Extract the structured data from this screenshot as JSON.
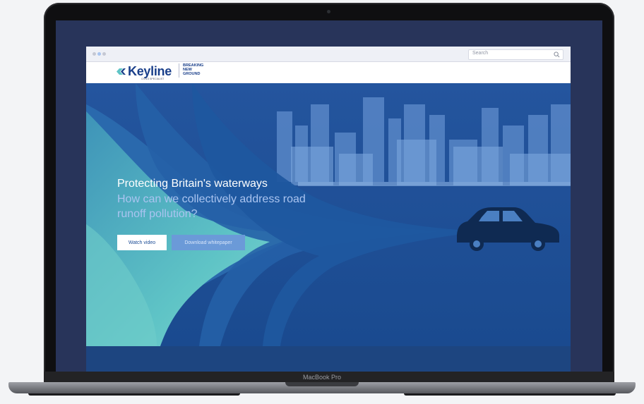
{
  "browser": {
    "search_placeholder": "Search"
  },
  "site": {
    "logo_text": "Keyline",
    "logo_subtext": "CIVILS SPECIALIST",
    "campaign_mark": [
      "BREAKING",
      "NEW",
      "GROUND"
    ]
  },
  "hero": {
    "heading": "Protecting Britain's waterways",
    "subheading": "How can we collectively address road runoff pollution?",
    "primary_button": "Watch video",
    "secondary_button": "Download whitepaper"
  },
  "device": {
    "model_label": "MacBook Pro"
  },
  "colors": {
    "brand_navy": "#1a3f8a",
    "hero_blue": "#1d4d96",
    "accent_teal": "#5fc4c6",
    "button_light": "#6b9ad8"
  }
}
